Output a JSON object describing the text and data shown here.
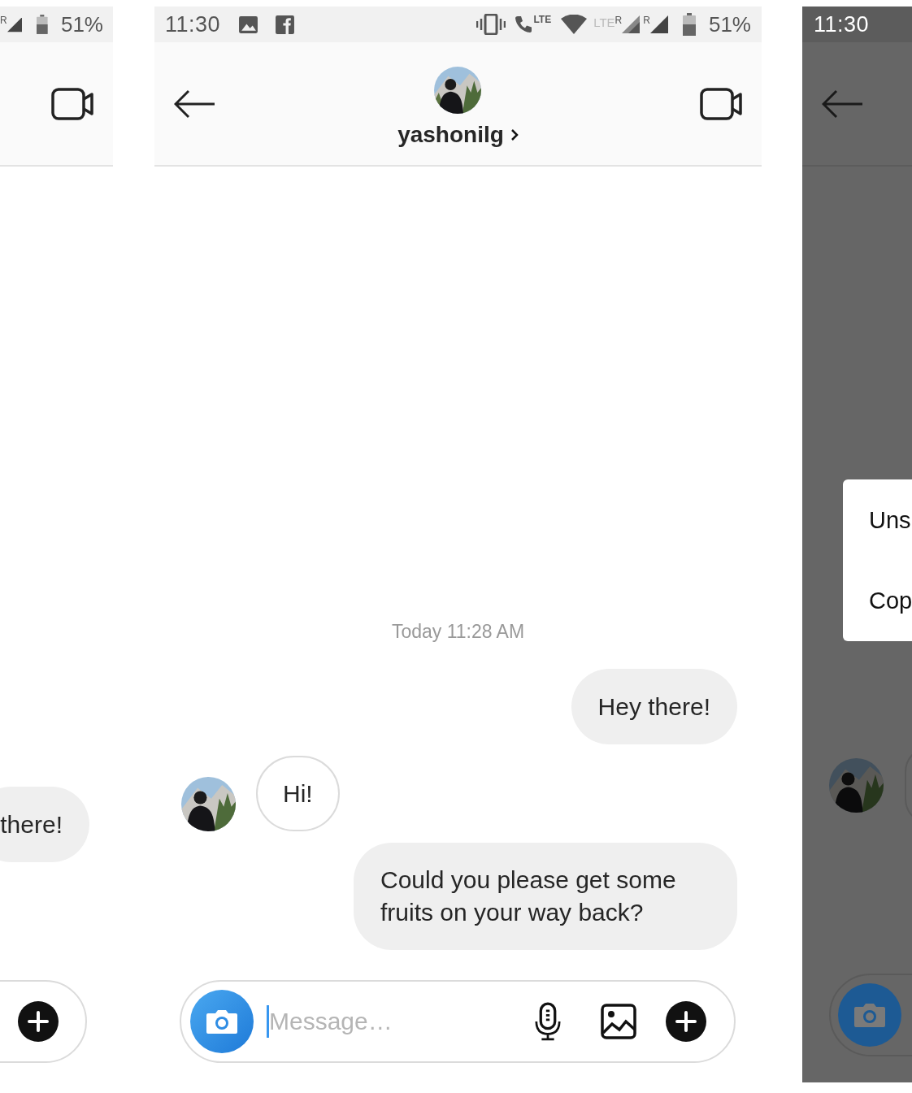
{
  "left_screen": {
    "status_bar": {
      "roaming_label": "R",
      "battery_text": "51%"
    },
    "messages": [
      {
        "kind": "sent",
        "text": "there!"
      }
    ]
  },
  "main_screen": {
    "status_bar": {
      "time": "11:30",
      "call_label": "LTE",
      "data_label": "LTE",
      "roaming_labels": [
        "R",
        "R"
      ],
      "battery_text": "51%"
    },
    "header": {
      "username": "yashonilg"
    },
    "timestamp": "Today 11:28 AM",
    "messages": [
      {
        "kind": "sent",
        "text": "Hey there!"
      },
      {
        "kind": "received",
        "text": "Hi!"
      },
      {
        "kind": "sent",
        "text": "Could you please get some fruits on your way back?"
      }
    ],
    "composer": {
      "placeholder": "Message…"
    }
  },
  "right_screen": {
    "status_bar": {
      "time": "11:30"
    },
    "menu": {
      "items": [
        "Uns",
        "Cop"
      ]
    }
  }
}
